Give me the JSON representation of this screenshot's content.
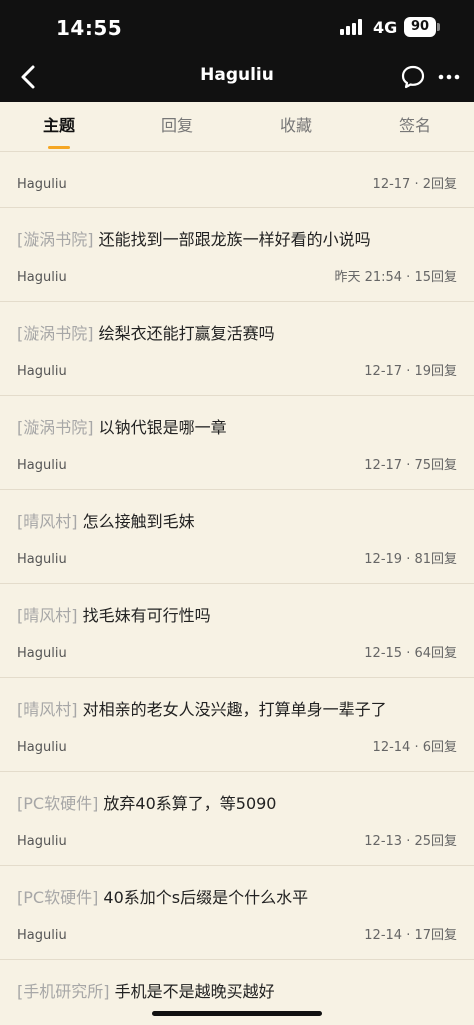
{
  "status": {
    "time": "14:55",
    "network": "4G",
    "battery": "90"
  },
  "nav": {
    "title": "Haguliu"
  },
  "tabs": [
    {
      "label": "主题"
    },
    {
      "label": "回复"
    },
    {
      "label": "收藏"
    },
    {
      "label": "签名"
    }
  ],
  "posts": [
    {
      "forum": "",
      "title": "",
      "author": "Haguliu",
      "meta": "12-17 · 2回复"
    },
    {
      "forum": "[漩涡书院]",
      "title": "还能找到一部跟龙族一样好看的小说吗",
      "author": "Haguliu",
      "meta": "昨天 21:54 · 15回复"
    },
    {
      "forum": "[漩涡书院]",
      "title": "绘梨衣还能打赢复活赛吗",
      "author": "Haguliu",
      "meta": "12-17 · 19回复"
    },
    {
      "forum": "[漩涡书院]",
      "title": "以钠代银是哪一章",
      "author": "Haguliu",
      "meta": "12-17 · 75回复"
    },
    {
      "forum": "[晴风村]",
      "title": "怎么接触到毛妹",
      "author": "Haguliu",
      "meta": "12-19 · 81回复"
    },
    {
      "forum": "[晴风村]",
      "title": "找毛妹有可行性吗",
      "author": "Haguliu",
      "meta": "12-15 · 64回复"
    },
    {
      "forum": "[晴风村]",
      "title": "对相亲的老女人没兴趣，打算单身一辈子了",
      "author": "Haguliu",
      "meta": "12-14 · 6回复"
    },
    {
      "forum": "[PC软硬件]",
      "title": "放弃40系算了，等5090",
      "author": "Haguliu",
      "meta": "12-13 · 25回复"
    },
    {
      "forum": "[PC软硬件]",
      "title": "40系加个s后缀是个什么水平",
      "author": "Haguliu",
      "meta": "12-14 · 17回复"
    },
    {
      "forum": "[手机研究所]",
      "title": "手机是不是越晚买越好",
      "author": "",
      "meta": ""
    }
  ]
}
